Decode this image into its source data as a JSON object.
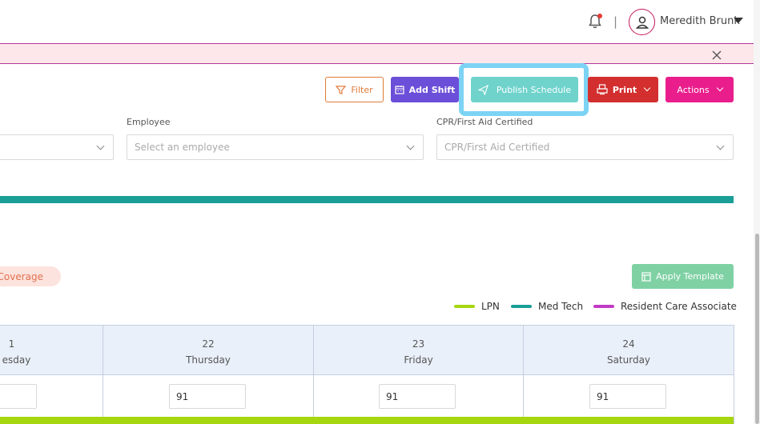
{
  "header": {
    "user_name": "Meredith Brunk",
    "separator": "|"
  },
  "toolbar": {
    "filter_label": "Filter",
    "add_shift_label": "Add Shift",
    "publish_label": "Publish Schedule",
    "print_label": "Print",
    "actions_label": "Actions"
  },
  "filters": {
    "employee_label": "Employee",
    "employee_placeholder": "Select an employee",
    "cpr_label": "CPR/First Aid Certified",
    "cpr_placeholder": "CPR/First Aid Certified"
  },
  "coverage_label": "Coverage",
  "apply_template_label": "Apply Template",
  "legend": [
    {
      "label": "LPN",
      "color": "#a6d60f"
    },
    {
      "label": "Med Tech",
      "color": "#1a9e96"
    },
    {
      "label": "Resident Care Associate",
      "color": "#c03bc4"
    }
  ],
  "calendar": {
    "days": [
      {
        "date": "1",
        "weekday": "esday",
        "count": ""
      },
      {
        "date": "22",
        "weekday": "Thursday",
        "count": "91"
      },
      {
        "date": "23",
        "weekday": "Friday",
        "count": "91"
      },
      {
        "date": "24",
        "weekday": "Saturday",
        "count": "91"
      }
    ]
  },
  "colors": {
    "filter": "#e07b39",
    "add_shift": "#6c4fd8",
    "publish": "#6fd3cc",
    "print": "#d32f2f",
    "actions": "#e91e8c",
    "apply_template": "#7fd1a4",
    "highlight": "#7dd3f4"
  },
  "icons": {
    "bell": "bell-icon",
    "avatar": "user-icon",
    "close": "close-icon",
    "filter": "filter-icon",
    "add_shift": "calendar-icon",
    "publish": "send-icon",
    "print": "printer-icon",
    "template": "template-icon"
  }
}
